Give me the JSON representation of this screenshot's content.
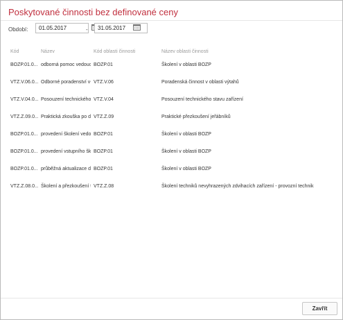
{
  "dialog": {
    "title": "Poskytované činnosti bez definované ceny"
  },
  "filter": {
    "label": "Období:",
    "date_from": "01.05.2017",
    "separator": "-",
    "date_to": "31.05.2017"
  },
  "table": {
    "columns": [
      "Kód",
      "Název",
      "Kód oblasti činnosti",
      "Název oblasti činnosti"
    ],
    "rows": [
      [
        "BOZP.01.0...",
        "odborná pomoc vedouc...",
        "BOZP.01",
        "Školení v oblasti BOZP"
      ],
      [
        "VTZ.V.06.0...",
        "Odborné poradenství v-...",
        "VTZ.V.06",
        "Poradenská činnost v oblasti výtahů"
      ],
      [
        "VTZ.V.04.0...",
        "Posouzení technického...",
        "VTZ.V.04",
        "Posouzení technického stavu zařízení"
      ],
      [
        "VTZ.Z.09.0...",
        "Praktická zkouška po d...",
        "VTZ.Z.09",
        "Praktické přezkoušení jeřábníků"
      ],
      [
        "BOZP.01.0...",
        "provedení školení vedo...",
        "BOZP.01",
        "Školení v oblasti BOZP"
      ],
      [
        "BOZP.01.0...",
        "provedení vstupního šk...",
        "BOZP.01",
        "Školení v oblasti BOZP"
      ],
      [
        "BOZP.01.0...",
        "průběžná aktualizace d...",
        "BOZP.01",
        "Školení v oblasti BOZP"
      ],
      [
        "VTZ.Z.08.0...",
        "Školení a přezkoušení t...",
        "VTZ.Z.08",
        "Školení techniků nevyhrazených zdvihacích zařízení - provozní technik"
      ]
    ]
  },
  "footer": {
    "close_label": "Zavřít"
  },
  "colors": {
    "title": "#c1303f",
    "header_text": "#9a9a9a"
  },
  "icons": {
    "date_picker": "calendar-icon"
  }
}
